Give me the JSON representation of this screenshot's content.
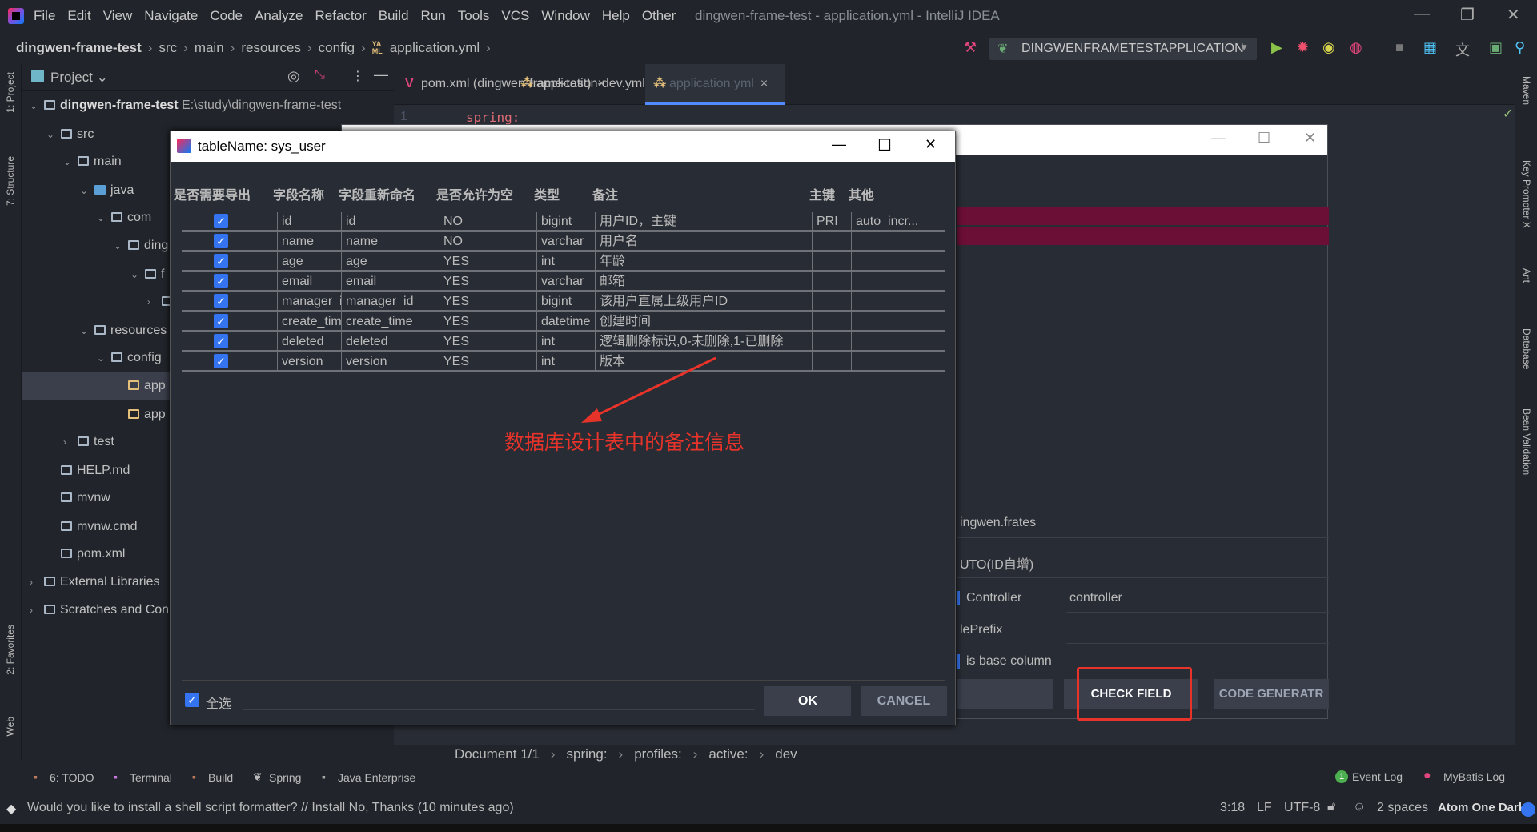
{
  "menubar": {
    "items": [
      "File",
      "Edit",
      "View",
      "Navigate",
      "Code",
      "Analyze",
      "Refactor",
      "Build",
      "Run",
      "Tools",
      "VCS",
      "Window",
      "Help",
      "Other"
    ],
    "title": "dingwen-frame-test - application.yml - IntelliJ IDEA"
  },
  "breadcrumb": [
    "dingwen-frame-test",
    "src",
    "main",
    "resources",
    "config",
    "application.yml"
  ],
  "toolbar": {
    "run_config": "DINGWENFRAMETESTAPPLICATION"
  },
  "left_strip": [
    "1: Project",
    "7: Structure",
    "2: Favorites",
    "Web"
  ],
  "right_strip": [
    "Maven",
    "Key Promoter X",
    "Ant",
    "Database",
    "Bean Validation"
  ],
  "project": {
    "title": "Project",
    "tree": [
      {
        "label": "dingwen-frame-test",
        "path": "E:\\study\\dingwen-frame-test",
        "depth": 0,
        "chev": "v"
      },
      {
        "label": "src",
        "depth": 1,
        "chev": "v"
      },
      {
        "label": "main",
        "depth": 2,
        "chev": "v"
      },
      {
        "label": "java",
        "depth": 3,
        "chev": "v"
      },
      {
        "label": "com",
        "depth": 4,
        "chev": "v"
      },
      {
        "label": "ding",
        "depth": 5,
        "chev": "v"
      },
      {
        "label": "f",
        "depth": 6,
        "chev": "v"
      },
      {
        "label": "",
        "depth": 7,
        "chev": ">"
      },
      {
        "label": "resources",
        "depth": 3,
        "chev": "v"
      },
      {
        "label": "config",
        "depth": 4,
        "chev": "v"
      },
      {
        "label": "app",
        "depth": 5,
        "chev": "",
        "selected": true
      },
      {
        "label": "app",
        "depth": 5,
        "chev": ""
      },
      {
        "label": "test",
        "depth": 2,
        "chev": ">"
      },
      {
        "label": "HELP.md",
        "depth": 1,
        "chev": ""
      },
      {
        "label": "mvnw",
        "depth": 1,
        "chev": ""
      },
      {
        "label": "mvnw.cmd",
        "depth": 1,
        "chev": ""
      },
      {
        "label": "pom.xml",
        "depth": 1,
        "chev": ""
      },
      {
        "label": "External Libraries",
        "depth": 0,
        "chev": ">"
      },
      {
        "label": "Scratches and Con",
        "depth": 0,
        "chev": ">"
      }
    ]
  },
  "editor": {
    "tabs": [
      "pom.xml (dingwen-frame-test)",
      "application-dev.yml",
      "application.yml"
    ],
    "active_tab": 2,
    "line_no": "1",
    "code": "spring:",
    "path": [
      "Document 1/1",
      "spring:",
      "profiles:",
      "active:",
      "dev"
    ]
  },
  "bg_window": {
    "fields": [
      "ingwen.frates",
      "UTO(ID自增)",
      "Controller",
      "controller",
      "lePrefix",
      "is base column"
    ],
    "buttons": [
      "",
      "CHECK FIELD",
      "CODE GENERATR"
    ]
  },
  "dialog": {
    "title": "tableName: sys_user",
    "columns": [
      "是否需要导出",
      "字段名称",
      "字段重新命名",
      "是否允许为空",
      "类型",
      "备注",
      "主键",
      "其他"
    ],
    "rows": [
      [
        "id",
        "id",
        "NO",
        "bigint",
        "用户ID，主键",
        "PRI",
        "auto_incr..."
      ],
      [
        "name",
        "name",
        "NO",
        "varchar",
        "用户名",
        "",
        ""
      ],
      [
        "age",
        "age",
        "YES",
        "int",
        "年龄",
        "",
        ""
      ],
      [
        "email",
        "email",
        "YES",
        "varchar",
        "邮箱",
        "",
        ""
      ],
      [
        "manager_id",
        "manager_id",
        "YES",
        "bigint",
        "该用户直属上级用户ID",
        "",
        ""
      ],
      [
        "create_time",
        "create_time",
        "YES",
        "datetime",
        "创建时间",
        "",
        ""
      ],
      [
        "deleted",
        "deleted",
        "YES",
        "int",
        "逻辑删除标识,0-未删除,1-已删除",
        "",
        ""
      ],
      [
        "version",
        "version",
        "YES",
        "int",
        "版本",
        "",
        ""
      ]
    ],
    "select_all": "全选",
    "ok": "OK",
    "cancel": "CANCEL"
  },
  "annotation": "数据库设计表中的备注信息",
  "tool_windows": [
    "6: TODO",
    "Terminal",
    "Build",
    "Spring",
    "Java Enterprise"
  ],
  "tool_windows_right": [
    "Event Log",
    "MyBatis Log"
  ],
  "event_count": "1",
  "status": {
    "message": "Would you like to install a shell script formatter? // Install   No, Thanks (10 minutes ago)",
    "position": "3:18",
    "line_sep": "LF",
    "encoding": "UTF-8",
    "indent": "2 spaces",
    "theme": "Atom One Dark"
  },
  "colors": {
    "accent": "#3574f0",
    "annotation": "#e8332a",
    "highlight_row": "#6b0f36"
  }
}
